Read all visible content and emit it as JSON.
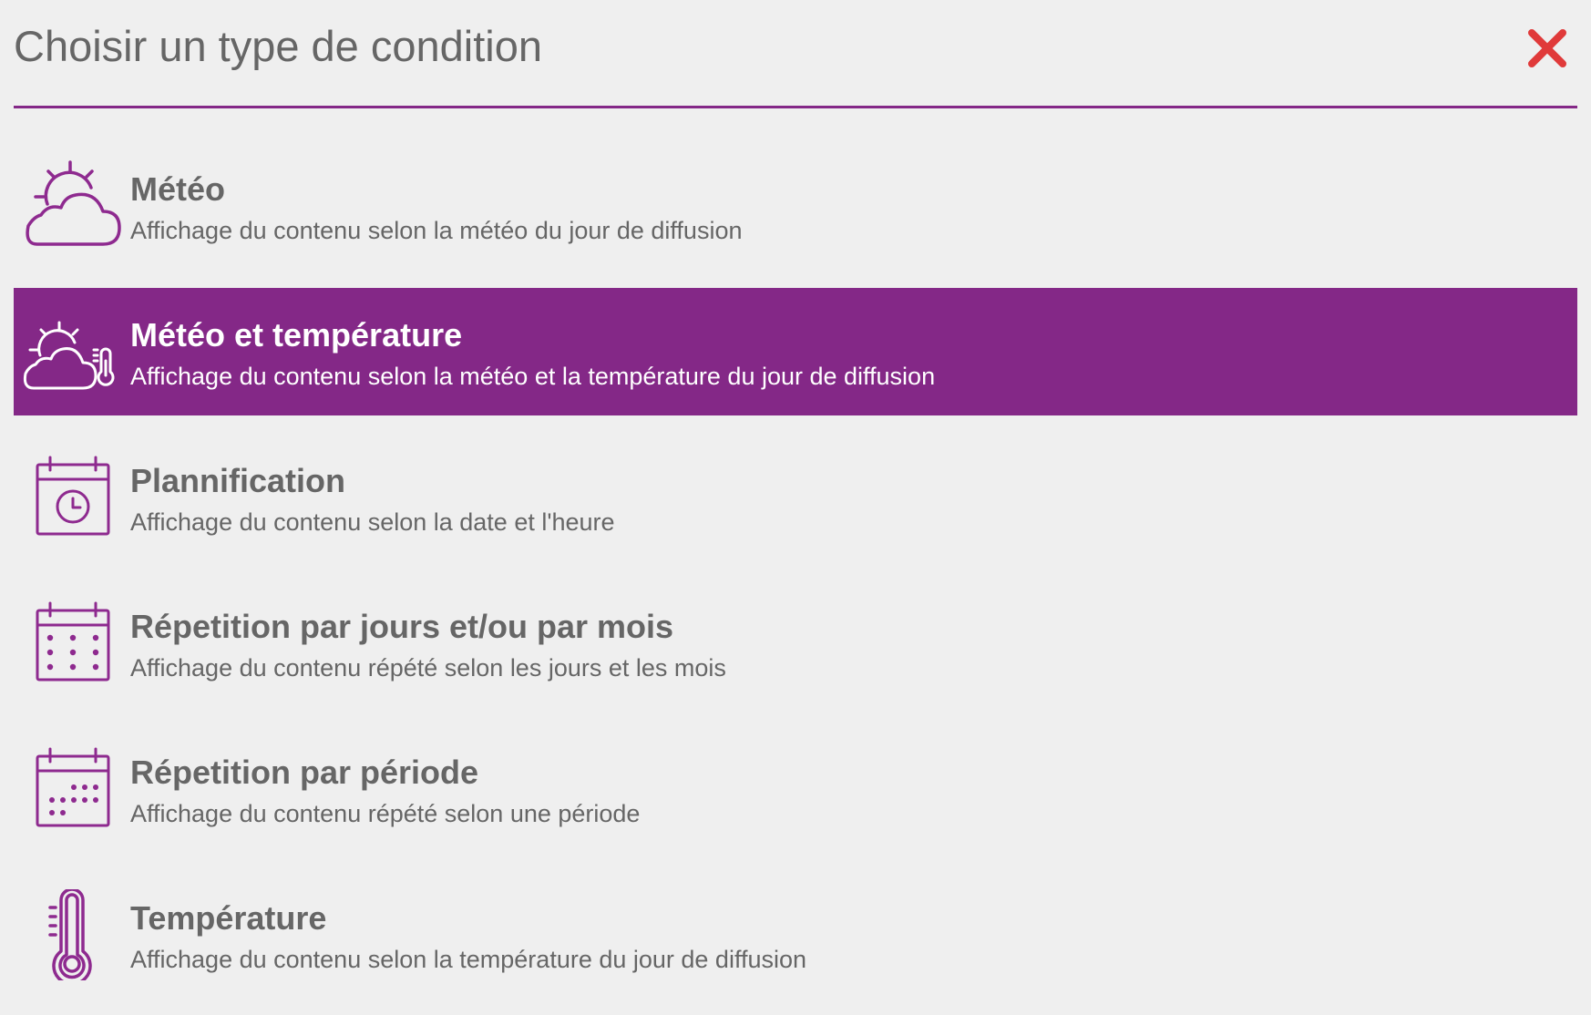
{
  "dialog": {
    "title": "Choisir un type de condition",
    "close_icon": "close-x-icon",
    "accent_color": "#842887",
    "close_color": "#e03a3a"
  },
  "conditions": [
    {
      "icon": "weather-icon",
      "title": "Météo",
      "description": "Affichage du contenu selon la météo du jour de diffusion",
      "selected": false
    },
    {
      "icon": "weather-temperature-icon",
      "title": "Météo et température",
      "description": "Affichage du contenu selon la météo et la température du jour de diffusion",
      "selected": true
    },
    {
      "icon": "calendar-clock-icon",
      "title": "Plannification",
      "description": "Affichage du contenu selon la date et l'heure",
      "selected": false
    },
    {
      "icon": "calendar-grid-icon",
      "title": "Répetition par jours et/ou par mois",
      "description": "Affichage du contenu répété selon les jours et les mois",
      "selected": false
    },
    {
      "icon": "calendar-period-icon",
      "title": "Répetition par période",
      "description": "Affichage du contenu répété selon une période",
      "selected": false
    },
    {
      "icon": "thermometer-icon",
      "title": "Température",
      "description": "Affichage du contenu selon la température du jour de diffusion",
      "selected": false
    }
  ]
}
